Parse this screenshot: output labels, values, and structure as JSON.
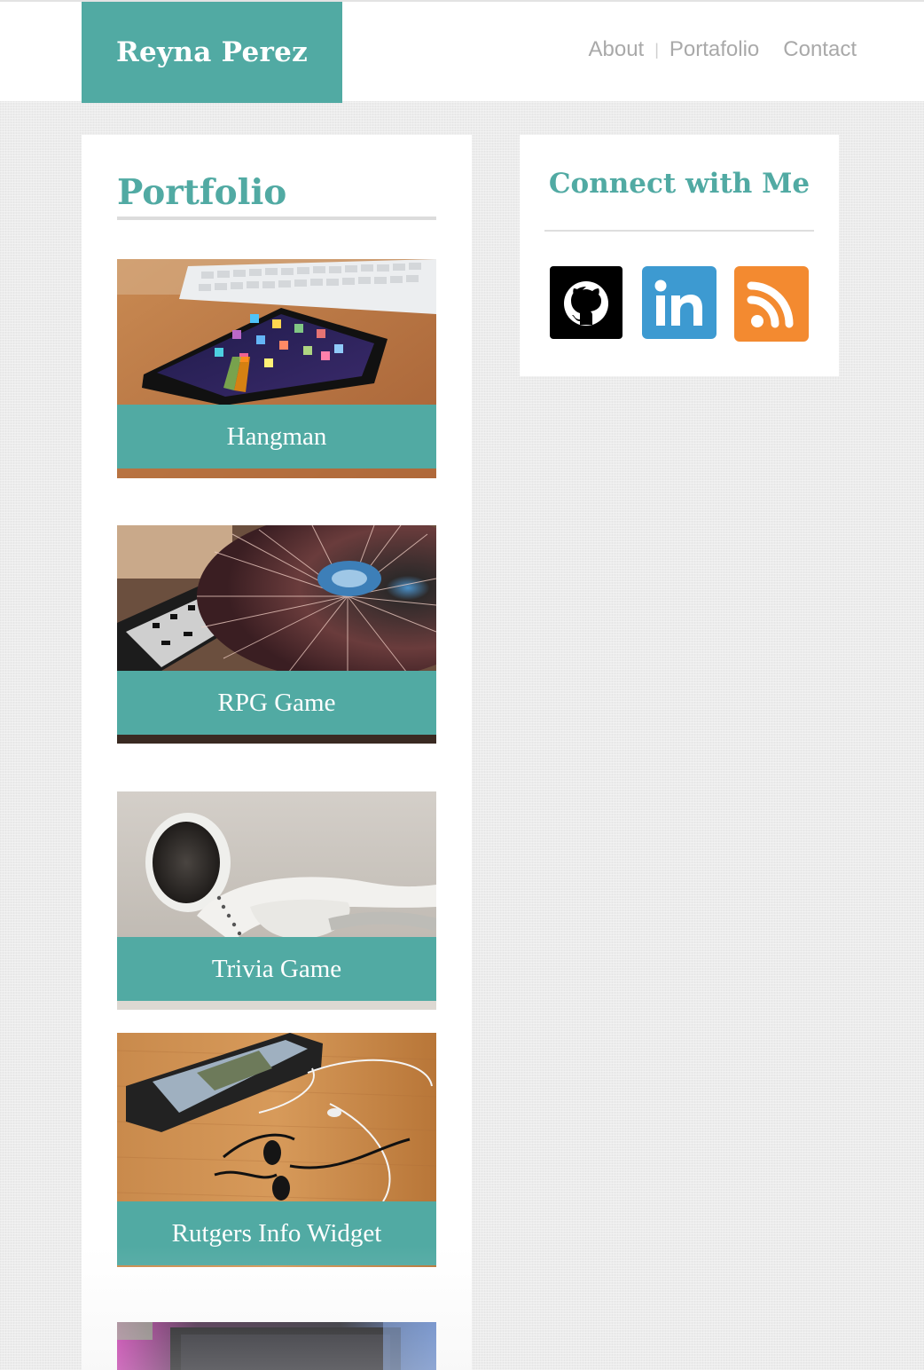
{
  "header": {
    "brand": "Reyna Perez",
    "nav": [
      {
        "label": "About"
      },
      {
        "separator": "|"
      },
      {
        "label": "Portafolio"
      },
      {
        "label": "Contact"
      }
    ]
  },
  "portfolio": {
    "title": "Portfolio",
    "projects": [
      {
        "name": "Hangman",
        "image": "tablet-on-desk-photo"
      },
      {
        "name": "RPG Game",
        "image": "dj-turntable-photo"
      },
      {
        "name": "Trivia Game",
        "image": "earbuds-photo"
      },
      {
        "name": "Rutgers Info Widget",
        "image": "smartphone-headphones-photo"
      },
      {
        "image": "monitor-desk-photo"
      }
    ]
  },
  "connect": {
    "title": "Connect with Me",
    "links": [
      {
        "icon": "github-icon",
        "color": "#000000"
      },
      {
        "icon": "linkedin-icon",
        "color": "#3d9ad1"
      },
      {
        "icon": "rss-icon",
        "color": "#f38a30"
      }
    ]
  },
  "colors": {
    "accent": "#51aaa3",
    "nav_text": "#a9a9a9",
    "page_background": "#ececec"
  }
}
